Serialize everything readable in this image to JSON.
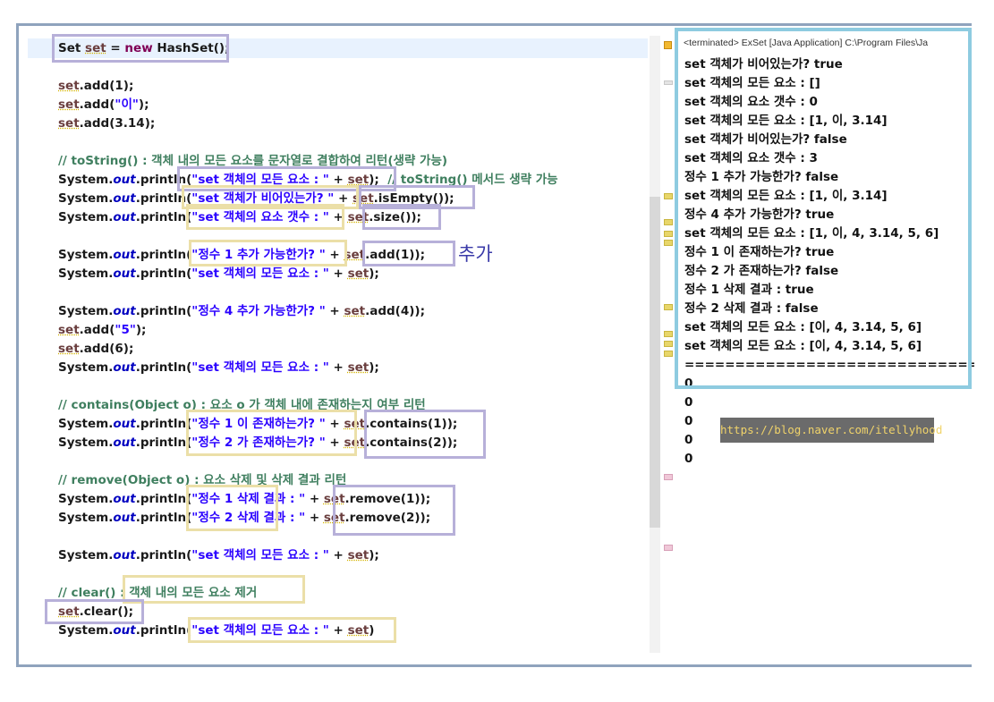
{
  "editor": {
    "lines": [
      {
        "id": "l1",
        "parts": [
          {
            "t": "Set",
            "c": ""
          },
          {
            "t": " ",
            "c": ""
          },
          {
            "t": "set",
            "c": "var"
          },
          {
            "t": " = ",
            "c": ""
          },
          {
            "t": "new",
            "c": "kw"
          },
          {
            "t": " HashSet();",
            "c": ""
          }
        ]
      },
      {
        "id": "l2",
        "parts": [
          {
            "t": "set",
            "c": "var"
          },
          {
            "t": ".add(1);",
            "c": ""
          }
        ]
      },
      {
        "id": "l3",
        "parts": [
          {
            "t": "set",
            "c": "var"
          },
          {
            "t": ".add(",
            "c": ""
          },
          {
            "t": "\"이\"",
            "c": "str"
          },
          {
            "t": ");",
            "c": ""
          }
        ]
      },
      {
        "id": "l4",
        "parts": [
          {
            "t": "set",
            "c": "var"
          },
          {
            "t": ".add(3.14);",
            "c": ""
          }
        ]
      },
      {
        "id": "l5",
        "parts": [
          {
            "t": "// toString() : 객체 내의 모든 요소를 문자열로 결합하여 리턴(생략 가능)",
            "c": "comment"
          }
        ]
      },
      {
        "id": "l6",
        "parts": [
          {
            "t": "System.",
            "c": ""
          },
          {
            "t": "out",
            "c": "fld"
          },
          {
            "t": ".println(",
            "c": ""
          },
          {
            "t": "\"set 객체의 모든 요소 : \"",
            "c": "str"
          },
          {
            "t": " + ",
            "c": ""
          },
          {
            "t": "set",
            "c": "var"
          },
          {
            "t": ");  ",
            "c": ""
          },
          {
            "t": "// toString() 메서드 생략 가능",
            "c": "comment"
          }
        ]
      },
      {
        "id": "l7",
        "parts": [
          {
            "t": "System.",
            "c": ""
          },
          {
            "t": "out",
            "c": "fld"
          },
          {
            "t": ".println(",
            "c": ""
          },
          {
            "t": "\"set 객체가 비어있는가? \"",
            "c": "str"
          },
          {
            "t": " + ",
            "c": ""
          },
          {
            "t": "set",
            "c": "var"
          },
          {
            "t": ".isEmpty());",
            "c": ""
          }
        ]
      },
      {
        "id": "l8",
        "parts": [
          {
            "t": "System.",
            "c": ""
          },
          {
            "t": "out",
            "c": "fld"
          },
          {
            "t": ".println(",
            "c": ""
          },
          {
            "t": "\"set 객체의 요소 갯수 : \"",
            "c": "str"
          },
          {
            "t": " + ",
            "c": ""
          },
          {
            "t": "set",
            "c": "var"
          },
          {
            "t": ".size());",
            "c": ""
          }
        ]
      },
      {
        "id": "l9",
        "parts": [
          {
            "t": "System.",
            "c": ""
          },
          {
            "t": "out",
            "c": "fld"
          },
          {
            "t": ".println(",
            "c": ""
          },
          {
            "t": "\"정수 1 추가 가능한가? \"",
            "c": "str"
          },
          {
            "t": " + ",
            "c": ""
          },
          {
            "t": "set",
            "c": "var"
          },
          {
            "t": ".add(1));",
            "c": ""
          }
        ]
      },
      {
        "id": "l10",
        "parts": [
          {
            "t": "System.",
            "c": ""
          },
          {
            "t": "out",
            "c": "fld"
          },
          {
            "t": ".println(",
            "c": ""
          },
          {
            "t": "\"set 객체의 모든 요소 : \"",
            "c": "str"
          },
          {
            "t": " + ",
            "c": ""
          },
          {
            "t": "set",
            "c": "var"
          },
          {
            "t": ");",
            "c": ""
          }
        ]
      },
      {
        "id": "l11",
        "parts": [
          {
            "t": "System.",
            "c": ""
          },
          {
            "t": "out",
            "c": "fld"
          },
          {
            "t": ".println(",
            "c": ""
          },
          {
            "t": "\"정수 4 추가 가능한가? \"",
            "c": "str"
          },
          {
            "t": " + ",
            "c": ""
          },
          {
            "t": "set",
            "c": "var"
          },
          {
            "t": ".add(4));",
            "c": ""
          }
        ]
      },
      {
        "id": "l12",
        "parts": [
          {
            "t": "set",
            "c": "var"
          },
          {
            "t": ".add(",
            "c": ""
          },
          {
            "t": "\"5\"",
            "c": "str"
          },
          {
            "t": ");",
            "c": ""
          }
        ]
      },
      {
        "id": "l13",
        "parts": [
          {
            "t": "set",
            "c": "var"
          },
          {
            "t": ".add(6);",
            "c": ""
          }
        ]
      },
      {
        "id": "l14",
        "parts": [
          {
            "t": "System.",
            "c": ""
          },
          {
            "t": "out",
            "c": "fld"
          },
          {
            "t": ".println(",
            "c": ""
          },
          {
            "t": "\"set 객체의 모든 요소 : \"",
            "c": "str"
          },
          {
            "t": " + ",
            "c": ""
          },
          {
            "t": "set",
            "c": "var"
          },
          {
            "t": ");",
            "c": ""
          }
        ]
      },
      {
        "id": "l15",
        "parts": [
          {
            "t": "// contains(Object o) : 요소 o 가 객체 내에 존재하는지 여부 리턴",
            "c": "comment"
          }
        ]
      },
      {
        "id": "l16",
        "parts": [
          {
            "t": "System.",
            "c": ""
          },
          {
            "t": "out",
            "c": "fld"
          },
          {
            "t": ".println(",
            "c": ""
          },
          {
            "t": "\"정수 1 이 존재하는가? \"",
            "c": "str"
          },
          {
            "t": " + ",
            "c": ""
          },
          {
            "t": "set",
            "c": "var"
          },
          {
            "t": ".contains(1));",
            "c": ""
          }
        ]
      },
      {
        "id": "l17",
        "parts": [
          {
            "t": "System.",
            "c": ""
          },
          {
            "t": "out",
            "c": "fld"
          },
          {
            "t": ".println(",
            "c": ""
          },
          {
            "t": "\"정수 2 가 존재하는가? \"",
            "c": "str"
          },
          {
            "t": " + ",
            "c": ""
          },
          {
            "t": "set",
            "c": "var"
          },
          {
            "t": ".contains(2));",
            "c": ""
          }
        ]
      },
      {
        "id": "l18",
        "parts": [
          {
            "t": "// remove(Object o) : 요소 삭제 및 삭제 결과 리턴",
            "c": "comment"
          }
        ]
      },
      {
        "id": "l19",
        "parts": [
          {
            "t": "System.",
            "c": ""
          },
          {
            "t": "out",
            "c": "fld"
          },
          {
            "t": ".println(",
            "c": ""
          },
          {
            "t": "\"정수 1 삭제 결과 : \"",
            "c": "str"
          },
          {
            "t": " + ",
            "c": ""
          },
          {
            "t": "set",
            "c": "var"
          },
          {
            "t": ".remove(1));",
            "c": ""
          }
        ]
      },
      {
        "id": "l20",
        "parts": [
          {
            "t": "System.",
            "c": ""
          },
          {
            "t": "out",
            "c": "fld"
          },
          {
            "t": ".println(",
            "c": ""
          },
          {
            "t": "\"정수 2 삭제 결과 : \"",
            "c": "str"
          },
          {
            "t": " + ",
            "c": ""
          },
          {
            "t": "set",
            "c": "var"
          },
          {
            "t": ".remove(2));",
            "c": ""
          }
        ]
      },
      {
        "id": "l21",
        "parts": [
          {
            "t": "System.",
            "c": ""
          },
          {
            "t": "out",
            "c": "fld"
          },
          {
            "t": ".println(",
            "c": ""
          },
          {
            "t": "\"set 객체의 모든 요소 : \"",
            "c": "str"
          },
          {
            "t": " + ",
            "c": ""
          },
          {
            "t": "set",
            "c": "var"
          },
          {
            "t": ");",
            "c": ""
          }
        ]
      },
      {
        "id": "l22",
        "parts": [
          {
            "t": "// clear() : 객체 내의 모든 요소 제거",
            "c": "comment"
          }
        ]
      },
      {
        "id": "l23",
        "parts": [
          {
            "t": "set",
            "c": "var"
          },
          {
            "t": ".clear();",
            "c": ""
          }
        ]
      },
      {
        "id": "l24",
        "parts": [
          {
            "t": "System.",
            "c": ""
          },
          {
            "t": "out",
            "c": "fld"
          },
          {
            "t": ".println(",
            "c": ""
          },
          {
            "t": "\"set 객체의 모든 요소 : \"",
            "c": "str"
          },
          {
            "t": " + ",
            "c": ""
          },
          {
            "t": "set",
            "c": "var"
          },
          {
            "t": ")",
            "c": ""
          }
        ]
      }
    ]
  },
  "annotation": "추가",
  "console": {
    "header": "<terminated> ExSet [Java Application] C:\\Program Files\\Ja",
    "lines": [
      "set 객체가 비어있는가? true",
      "set 객체의 모든 요소 : []",
      "set 객체의 요소 갯수 : 0",
      "set 객체의 모든 요소 : [1, 이, 3.14]",
      "set 객체가 비어있는가? false",
      "set 객체의 요소 갯수 : 3",
      "정수 1 추가 가능한가? false",
      "set 객체의 모든 요소 : [1, 이, 3.14]",
      "정수 4 추가 가능한가? true",
      "set 객체의 모든 요소 : [1, 이, 4, 3.14, 5, 6]",
      "정수 1 이 존재하는가? true",
      "정수 2 가 존재하는가? false",
      "정수 1 삭제 결과 : true",
      "정수 2 삭제 결과 : false",
      "set 객체의 모든 요소 : [이, 4, 3.14, 5, 6]",
      "set 객체의 모든 요소 : [이, 4, 3.14, 5, 6]",
      "==============================",
      "0",
      "0",
      "0",
      "0",
      "0"
    ]
  },
  "watermark": "https://blog.naver.com/itellyhood",
  "colors": {
    "keyword": "#7f0055",
    "comment": "#3f7f5f",
    "string": "#2a00ff",
    "field": "#0000c0",
    "highlight_purple": "#b7b0d9",
    "highlight_yellow": "#ebdfa8",
    "console_border": "#8ecbe0"
  }
}
